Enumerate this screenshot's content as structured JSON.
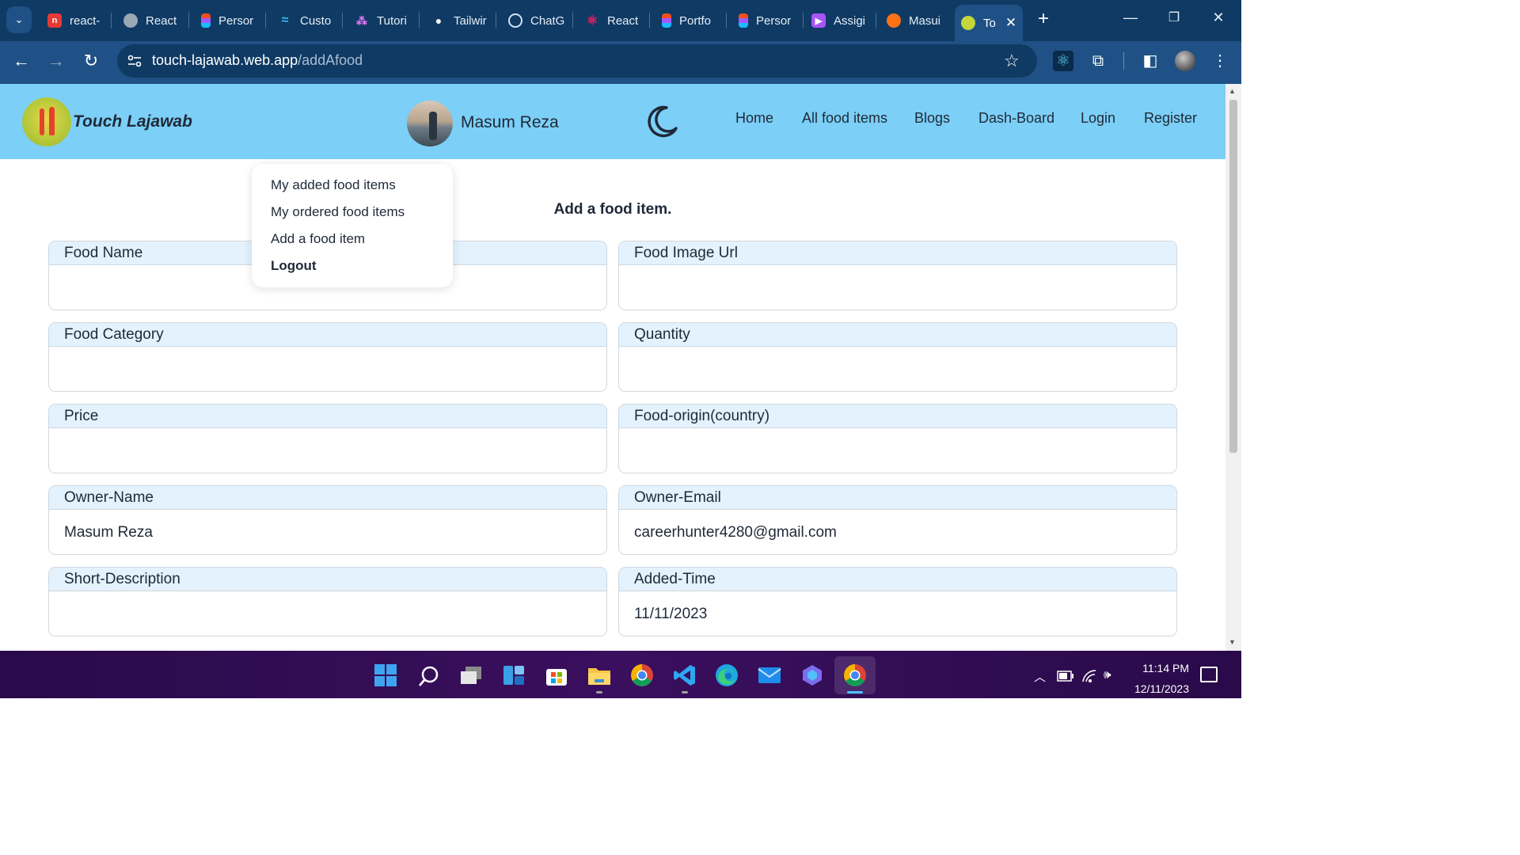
{
  "browser": {
    "tabs": [
      {
        "label": "react-",
        "icon": "red-square-icon",
        "color": "#e53935"
      },
      {
        "label": "React",
        "icon": "globe-icon",
        "color": "#9aa7b4"
      },
      {
        "label": "Persor",
        "icon": "figma-icon",
        "color": "#f24e1e"
      },
      {
        "label": "Custo",
        "icon": "tailwind-icon",
        "color": "#38bdf8"
      },
      {
        "label": "Tutori",
        "icon": "nodes-icon",
        "color": "#e879f9"
      },
      {
        "label": "Tailwir",
        "icon": "person-icon",
        "color": "#f5f5f5"
      },
      {
        "label": "ChatG",
        "icon": "chatgpt-icon",
        "color": "#10a37f"
      },
      {
        "label": "React",
        "icon": "react-atom-icon",
        "color": "#e91e63"
      },
      {
        "label": "Portfo",
        "icon": "figma-icon",
        "color": "#f24e1e"
      },
      {
        "label": "Persor",
        "icon": "figma-icon",
        "color": "#f24e1e"
      },
      {
        "label": "Assigi",
        "icon": "play-icon",
        "color": "#a855f7"
      },
      {
        "label": "Masui",
        "icon": "avatar-tab-icon",
        "color": "#f97316"
      }
    ],
    "active_tab": {
      "label": "To",
      "icon": "touch-lajawab-favicon",
      "color": "#c5d63a"
    },
    "url_host": "touch-lajawab.web.app",
    "url_path": "/addAfood"
  },
  "site": {
    "brand": "Touch Lajawab",
    "user_name": "Masum Reza",
    "nav": [
      "Home",
      "All food items",
      "Blogs",
      "Dash-Board",
      "Login",
      "Register"
    ],
    "nav_bg": "#7ccff7"
  },
  "dropdown": {
    "items": [
      "My added food items",
      "My ordered food items",
      "Add a food item",
      "Logout"
    ]
  },
  "form": {
    "title": "Add a food item.",
    "fields": [
      {
        "label": "Food Name",
        "value": ""
      },
      {
        "label": "Food Image Url",
        "value": ""
      },
      {
        "label": "Food Category",
        "value": ""
      },
      {
        "label": "Quantity",
        "value": ""
      },
      {
        "label": "Price",
        "value": ""
      },
      {
        "label": "Food-origin(country)",
        "value": ""
      },
      {
        "label": "Owner-Name",
        "value": "Masum Reza"
      },
      {
        "label": "Owner-Email",
        "value": "careerhunter4280@gmail.com"
      },
      {
        "label": "Short-Description",
        "value": ""
      },
      {
        "label": "Added-Time",
        "value": "11/11/2023"
      }
    ]
  },
  "taskbar": {
    "time": "11:14 PM",
    "date": "12/11/2023",
    "bg": "#2a0a4a"
  }
}
